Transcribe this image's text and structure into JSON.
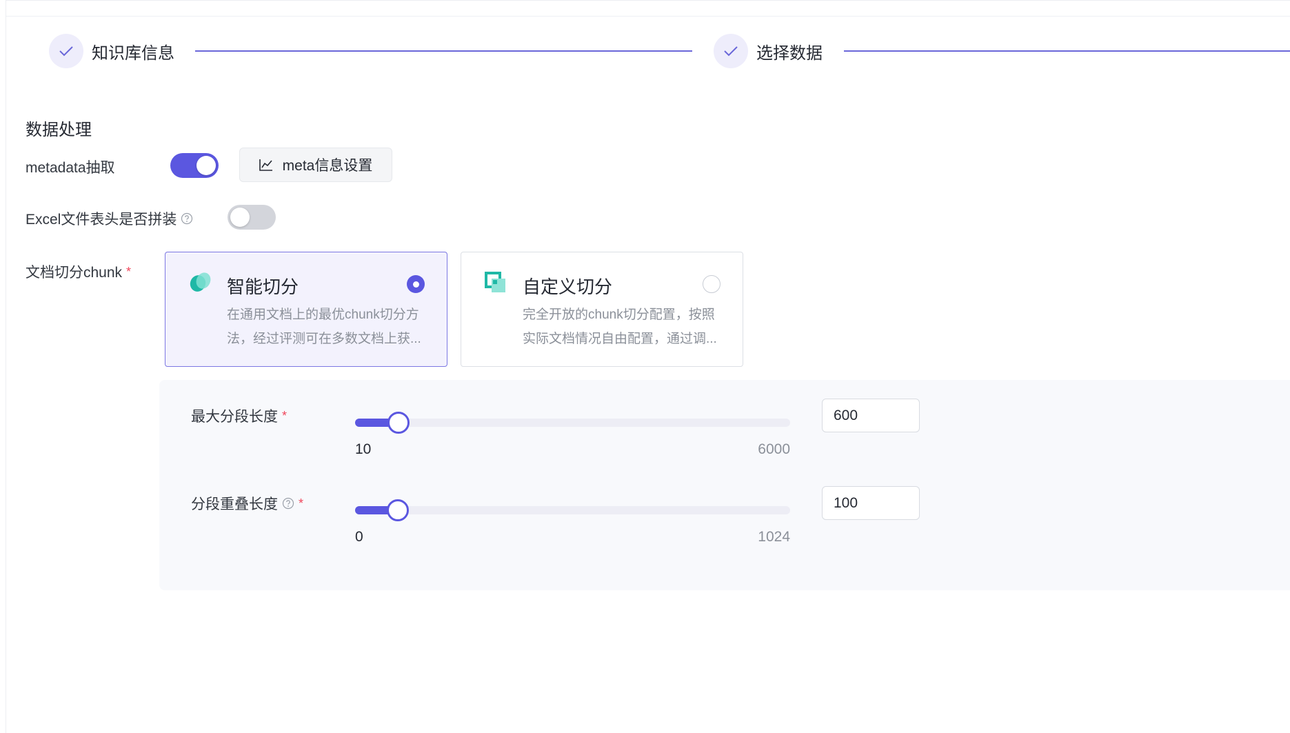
{
  "steps": [
    {
      "label": "知识库信息",
      "status": "done"
    },
    {
      "label": "选择数据",
      "status": "done"
    }
  ],
  "section": {
    "title": "数据处理"
  },
  "metadata": {
    "label": "metadata抽取",
    "enabled": true,
    "button_label": "meta信息设置"
  },
  "excel": {
    "label": "Excel文件表头是否拼装",
    "enabled": false
  },
  "chunk": {
    "label": "文档切分chunk",
    "required_mark": "*",
    "options": [
      {
        "title": "智能切分",
        "desc_line1": "在通用文档上的最优chunk切分方",
        "desc_line2": "法，经过评测可在多数文档上获...",
        "selected": true
      },
      {
        "title": "自定义切分",
        "desc_line1": "完全开放的chunk切分配置，按照",
        "desc_line2": "实际文档情况自由配置，通过调...",
        "selected": false
      }
    ]
  },
  "sliders": [
    {
      "label": "最大分段长度",
      "required_mark": "*",
      "has_help": false,
      "min": "10",
      "max": "6000",
      "value": "600",
      "fill_fraction": 0.1
    },
    {
      "label": "分段重叠长度",
      "required_mark": "*",
      "has_help": true,
      "min": "0",
      "max": "1024",
      "value": "100",
      "fill_fraction": 0.098
    }
  ],
  "colors": {
    "accent": "#5b57e0",
    "required": "#f0455a"
  }
}
